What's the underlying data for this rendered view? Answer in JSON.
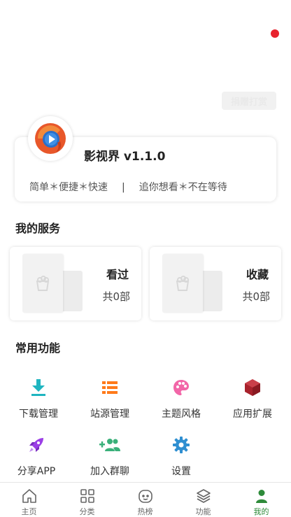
{
  "header": {
    "donate_label": "捐赠打赏"
  },
  "app": {
    "name": "影视界 v1.1.0",
    "slogan_left": "简单＊便捷＊快速",
    "separator": "|",
    "slogan_right": "追你想看＊不在等待"
  },
  "services": {
    "title": "我的服务",
    "items": [
      {
        "label": "看过",
        "count": "共0部"
      },
      {
        "label": "收藏",
        "count": "共0部"
      }
    ]
  },
  "functions": {
    "title": "常用功能",
    "items": [
      {
        "label": "下载管理",
        "icon": "download-icon",
        "color": "#1fb5c0"
      },
      {
        "label": "站源管理",
        "icon": "list-icon",
        "color": "#ff7a1a"
      },
      {
        "label": "主题风格",
        "icon": "palette-icon",
        "color": "#f266a8"
      },
      {
        "label": "应用扩展",
        "icon": "cube-icon",
        "color": "#a8222c"
      },
      {
        "label": "分享APP",
        "icon": "rocket-icon",
        "color": "#9b3fe6"
      },
      {
        "label": "加入群聊",
        "icon": "add-group-icon",
        "color": "#3ab07a"
      },
      {
        "label": "设置",
        "icon": "gear-icon",
        "color": "#2f8fd1"
      }
    ]
  },
  "nav": {
    "items": [
      {
        "label": "主页",
        "icon": "home-icon"
      },
      {
        "label": "分类",
        "icon": "grid-icon"
      },
      {
        "label": "热榜",
        "icon": "smile-icon"
      },
      {
        "label": "功能",
        "icon": "layers-icon"
      },
      {
        "label": "我的",
        "icon": "user-icon",
        "active": true
      }
    ],
    "active_color": "#2e8b3a"
  }
}
